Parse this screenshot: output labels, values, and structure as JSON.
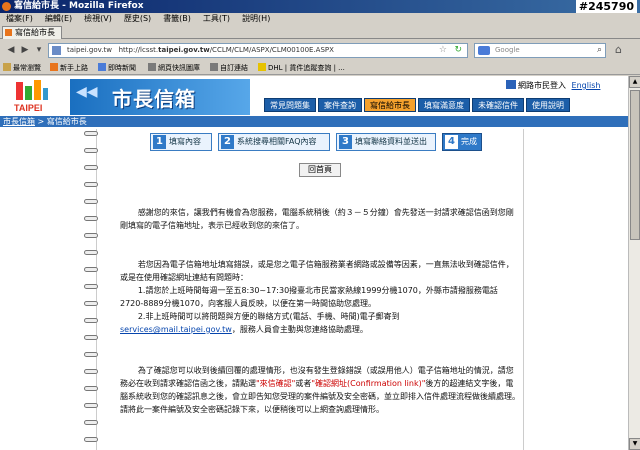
{
  "window": {
    "title": "寫信給市長 - Mozilla Firefox",
    "stamp": "#245790"
  },
  "menu": [
    "檔案(F)",
    "編輯(E)",
    "檢視(V)",
    "歷史(S)",
    "書籤(B)",
    "工具(T)",
    "說明(H)"
  ],
  "browser_tab": {
    "label": "寫信給市長",
    "close": "×"
  },
  "nav": {
    "url_domain": "taipei.gov.tw",
    "url_full_prefix": "http://lcsst.",
    "url_host_bold": "taipei.gov.tw",
    "url_path": "/CCLM/CLM/ASPX/CLM00100E.ASPX",
    "search_placeholder": "Google"
  },
  "bookmarks": [
    "最常瀏覽",
    "新手上路",
    "即時新聞",
    "網頁快訊圖庫",
    "自訂連結",
    "DHL | 貨件追蹤查詢 | ..."
  ],
  "site": {
    "logo_text": "TAIPEI",
    "banner_title": "市長信箱",
    "toplinks": {
      "login": "網路市民登入",
      "english": "English"
    },
    "tabs": [
      "常見問題集",
      "案件查詢",
      "寫信給市長",
      "填寫滿意度",
      "未確認信件",
      "使用說明"
    ],
    "active_tab": 2,
    "breadcrumb": {
      "home": "市長信箱",
      "sep": " > ",
      "current": "寫信給市長"
    }
  },
  "steps": [
    {
      "num": "1",
      "label": "填寫內容"
    },
    {
      "num": "2",
      "label": "系統搜尋相關FAQ內容"
    },
    {
      "num": "3",
      "label": "填寫聯絡資料並送出"
    },
    {
      "num": "4",
      "label": "完成"
    }
  ],
  "back_button": "回首頁",
  "paragraphs": {
    "p1": "感謝您的來信，讓我們有機會為您服務，電腦系統稍後（約３－５分鐘）會先發送一封請求確認信函到您剛剛填寫的電子信箱地址，表示已經收到您的來信了。",
    "p2a": "若您因為電子信箱地址填寫錯誤，或是您之電子信箱服務業者網路或設備等因素，一直無法收到確認信件，或是在使用確認網址連結有問題時：",
    "p2b": "1.請您於上班時間每週一至五8:30~17:30撥臺北市民當家熱線1999分機1070，外縣市請撥服務電話2720-8889分機1070，向客服人員反映，以便在第一時間協助您處理。",
    "p2c": "2.非上班時間可以將問題與方便的聯絡方式(電話、手機、時間)電子郵寄到",
    "p2d_link": "services@mail.taipei.gov.tw",
    "p2d_rest": "，服務人員會主動與您連絡協助處理。",
    "p3a": "為了確認您可以收到後續回覆的處理情形，也沒有發生登錄錯誤（或誤用他人）電子信箱地址的情況，請您務必在收到請求確認信函之後，請點選",
    "p3_red1": "\"來信確認\"",
    "p3_or": "或者",
    "p3_red2": "\"確認網址(Confirmation link)\"",
    "p3b": "後方的超連結文字後，電腦系統收到您的確認訊息之後，會立即告知您受理的案件編號及安全密碼，並立即排入信件處理流程做後續處理。請將此一案件編號及安全密碼記錄下來，以便稍後可以上網查詢處理情形。"
  },
  "colors": {
    "accent": "#2f79c8",
    "active_tab": "#f4a12d",
    "link": "#0645ad",
    "red": "#cc0000"
  }
}
